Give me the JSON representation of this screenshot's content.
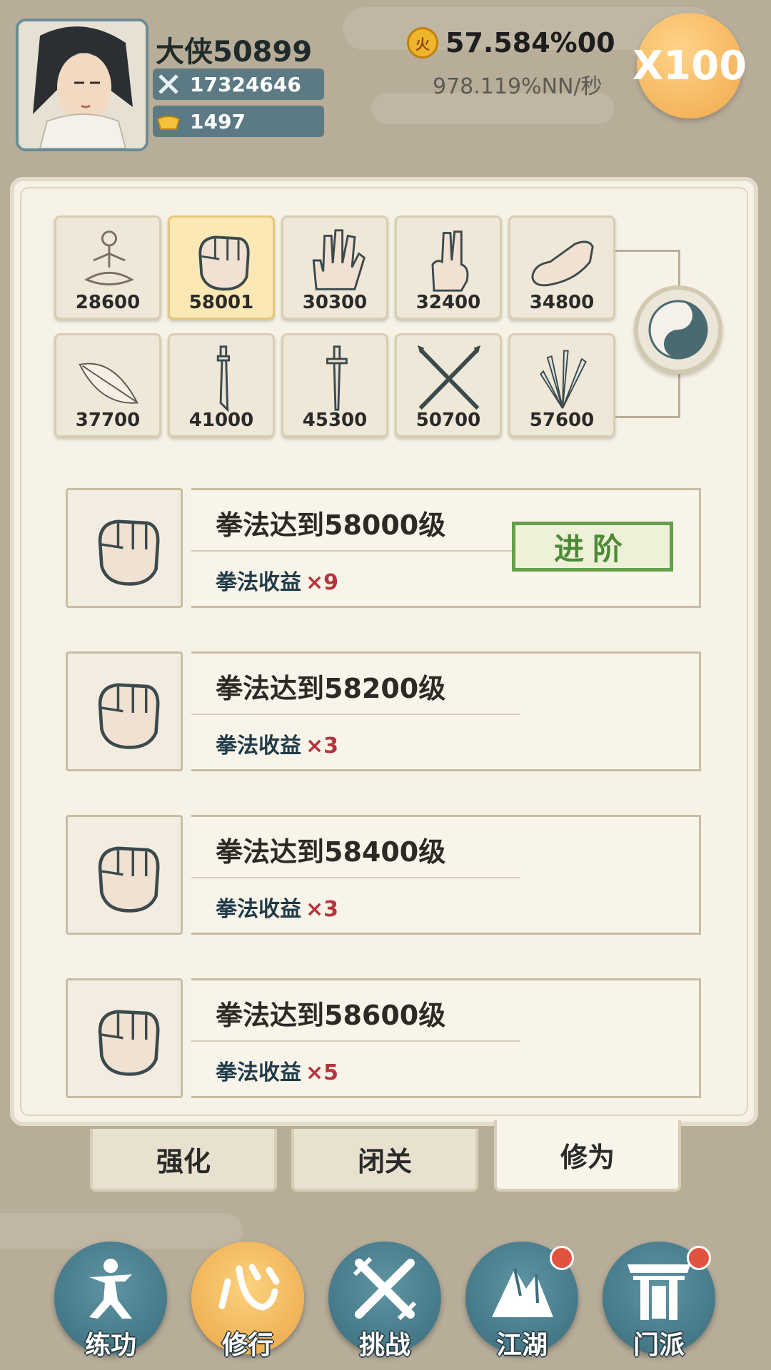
{
  "player": {
    "name": "大侠50899",
    "power": "17324646",
    "ingots": "1497"
  },
  "currency": {
    "gold": "57.584%00",
    "rate": "978.119%NN/秒",
    "multiplier": "X100"
  },
  "skills": [
    {
      "icon": "meditation-icon",
      "level": "28600",
      "active": false
    },
    {
      "icon": "fist-icon",
      "level": "58001",
      "active": true
    },
    {
      "icon": "palm-icon",
      "level": "30300",
      "active": false
    },
    {
      "icon": "two-finger-icon",
      "level": "32400",
      "active": false
    },
    {
      "icon": "shoe-icon",
      "level": "34800",
      "active": false
    },
    {
      "icon": "feather-icon",
      "level": "37700",
      "active": false
    },
    {
      "icon": "saber-icon",
      "level": "41000",
      "active": false
    },
    {
      "icon": "sword-icon",
      "level": "45300",
      "active": false
    },
    {
      "icon": "spear-icon",
      "level": "50700",
      "active": false
    },
    {
      "icon": "darts-icon",
      "level": "57600",
      "active": false
    }
  ],
  "tasks": [
    {
      "goal": "拳法达到58000级",
      "reward": "拳法收益",
      "mult": "×9",
      "button": "进阶"
    },
    {
      "goal": "拳法达到58200级",
      "reward": "拳法收益",
      "mult": "×3"
    },
    {
      "goal": "拳法达到58400级",
      "reward": "拳法收益",
      "mult": "×3"
    },
    {
      "goal": "拳法达到58600级",
      "reward": "拳法收益",
      "mult": "×5"
    }
  ],
  "subtabs": [
    "强化",
    "闭关",
    "修为"
  ],
  "nav": [
    {
      "label": "练功",
      "icon": "martial-figure-icon",
      "badge": false
    },
    {
      "label": "修行",
      "icon": "heart-character-icon",
      "badge": false
    },
    {
      "label": "挑战",
      "icon": "crossed-swords-icon",
      "badge": false
    },
    {
      "label": "江湖",
      "icon": "mountain-icon",
      "badge": true
    },
    {
      "label": "门派",
      "icon": "gate-icon",
      "badge": true
    }
  ],
  "colors": {
    "accent_green": "#64a04a",
    "reward_red": "#b5343a",
    "nav_teal": "#3b6c7c",
    "nav_active": "#eba445"
  }
}
